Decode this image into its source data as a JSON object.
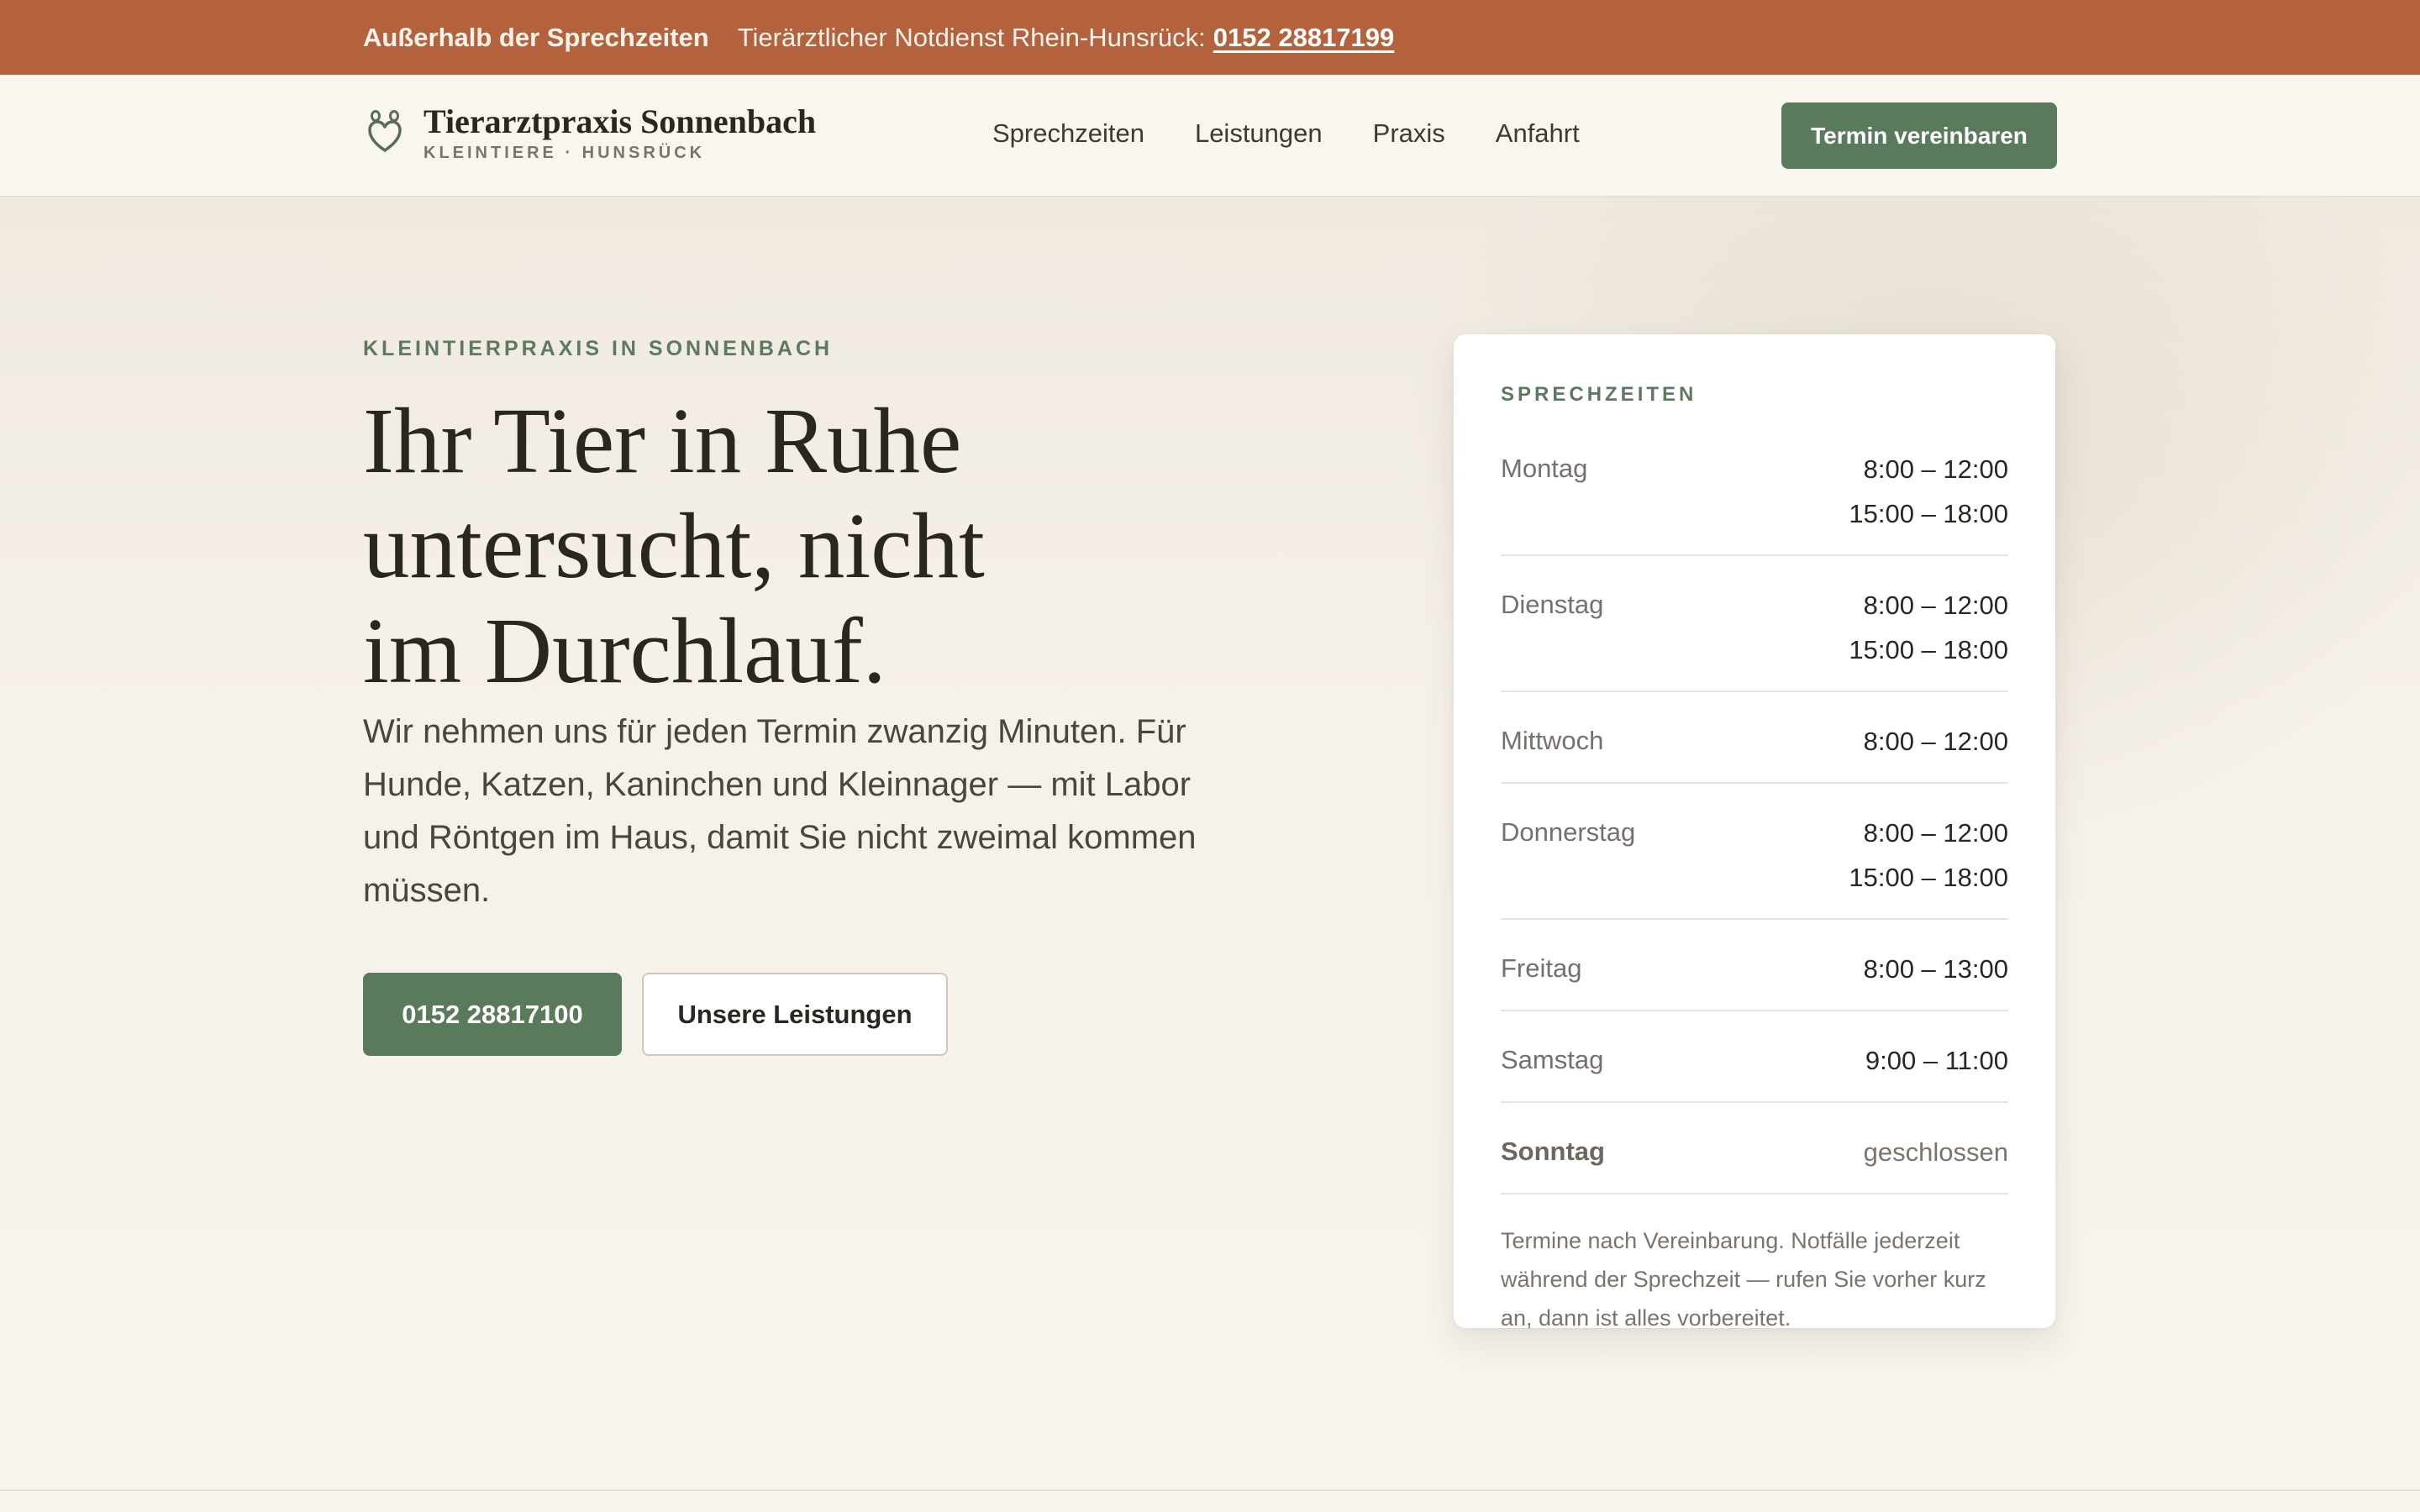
{
  "notice": {
    "label": "Außerhalb der Sprechzeiten",
    "text": "Tierärztlicher Notdienst Rhein-Hunsrück:",
    "phone": "0152 28817199"
  },
  "header": {
    "brand_name": "Tierarztpraxis Sonnenbach",
    "brand_sub": "KLEINTIERE · HUNSRÜCK",
    "logo_icon": "paw-heart-icon",
    "nav": [
      "Sprechzeiten",
      "Leistungen",
      "Praxis",
      "Anfahrt"
    ],
    "cta": "Termin vereinbaren"
  },
  "hero": {
    "eyebrow": "KLEINTIERPRAXIS IN SONNENBACH",
    "headline": [
      "Ihr Tier in Ruhe",
      "untersucht, nicht",
      "im Durchlauf."
    ],
    "lead": "Wir nehmen uns für jeden Termin zwanzig Minuten. Für Hunde, Katzen, Kaninchen und Kleinnager — mit Labor und Röntgen im Haus, damit Sie nicht zweimal kommen müssen.",
    "primary_button": "0152 28817100",
    "secondary_button": "Unsere Leistungen"
  },
  "hours": {
    "title": "SPRECHZEITEN",
    "rows": [
      {
        "day": "Montag",
        "times": [
          "8:00 – 12:00",
          "15:00 – 18:00"
        ]
      },
      {
        "day": "Dienstag",
        "times": [
          "8:00 – 12:00",
          "15:00 – 18:00"
        ]
      },
      {
        "day": "Mittwoch",
        "times": [
          "8:00 – 12:00"
        ]
      },
      {
        "day": "Donnerstag",
        "times": [
          "8:00 – 12:00",
          "15:00 – 18:00"
        ]
      },
      {
        "day": "Freitag",
        "times": [
          "8:00 – 13:00"
        ]
      },
      {
        "day": "Samstag",
        "times": [
          "9:00 – 11:00"
        ]
      },
      {
        "day": "Sonntag",
        "times": [
          "geschlossen"
        ]
      }
    ],
    "note": "Termine nach Vereinbarung. Notfälle jederzeit während der Sprechzeit — rufen Sie vorher kurz an, dann ist alles vorbereitet."
  },
  "colors": {
    "notice_bg": "#b4623e",
    "accent_green": "#5a7a5c",
    "page_bg": "#f8f4ee",
    "text_dark": "#2a2620"
  }
}
